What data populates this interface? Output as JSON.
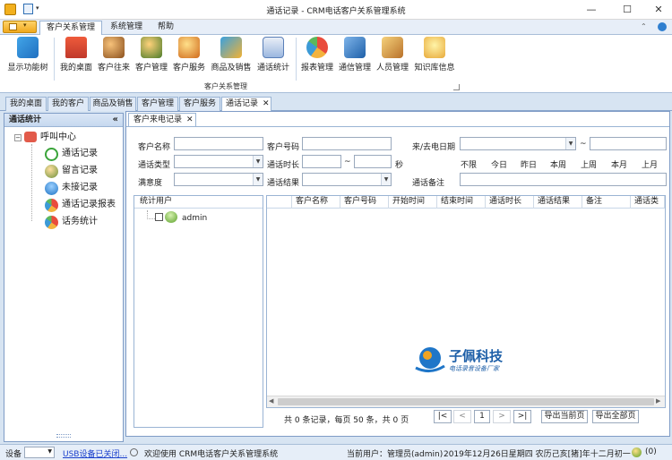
{
  "window": {
    "title": "通话记录 - CRM电话客户关系管理系统",
    "minimize": "—",
    "maximize": "☐",
    "close": "✕"
  },
  "ribbon_tabs": [
    "客户关系管理",
    "系统管理",
    "帮助"
  ],
  "ribbon_buttons": [
    {
      "label": "显示功能树",
      "icon": "tree-icon"
    },
    {
      "label": "我的桌面",
      "icon": "house-icon"
    },
    {
      "label": "客户往来",
      "icon": "people-icon"
    },
    {
      "label": "客户管理",
      "icon": "user-manage-icon"
    },
    {
      "label": "客户服务",
      "icon": "service-icon"
    },
    {
      "label": "商品及销售",
      "icon": "goods-icon"
    },
    {
      "label": "通话统计",
      "icon": "stats-icon"
    },
    {
      "label": "报表管理",
      "icon": "pie-chart-icon"
    },
    {
      "label": "通信管理",
      "icon": "communication-icon"
    },
    {
      "label": "人员管理",
      "icon": "staff-icon"
    },
    {
      "label": "知识库信息",
      "icon": "knowledge-icon"
    }
  ],
  "ribbon_group": "客户关系管理",
  "doc_tabs": [
    "我的桌面",
    "我的客户",
    "商品及销售",
    "客户管理",
    "客户服务",
    "通话记录"
  ],
  "left_panel": {
    "title": "通话统计",
    "collapse": "«",
    "root": "呼叫中心",
    "items": [
      "通话记录",
      "留言记录",
      "未接记录",
      "通话记录报表",
      "话务统计"
    ]
  },
  "inner_tab": "客户来电记录",
  "filters": {
    "customer_name": "客户名称",
    "customer_number": "客户号码",
    "call_date": "来/去电日期",
    "tilde": "~",
    "call_type": "通话类型",
    "duration": "通话时长",
    "seconds": "秒",
    "satisfaction": "满意度",
    "result": "通话结果",
    "remark": "通话备注",
    "quick": [
      "不限",
      "今日",
      "昨日",
      "本周",
      "上周",
      "本月",
      "上月"
    ]
  },
  "user_panel": {
    "title": "统计用户",
    "user": "admin"
  },
  "grid_columns": [
    "客户名称",
    "客户号码",
    "开始时间",
    "结束时间",
    "通话时长",
    "通话结果",
    "备注",
    "通话类"
  ],
  "watermark": {
    "name": "子佩科技",
    "slogan": "电话录音设备厂家"
  },
  "pager": {
    "summary": "共 0 条记录，每页 50 条，共 0 页",
    "first": "|<",
    "prev": "<",
    "page": "1",
    "next": ">",
    "last": ">|",
    "export_page": "导出当前页",
    "export_all": "导出全部页"
  },
  "status": {
    "device_label": "设备",
    "usb": "USB设备已关闭...",
    "welcome": "欢迎使用 CRM电话客户关系管理系统",
    "current_user": "当前用户：管理员(admin)",
    "datetime": "2019年12月26日星期四 农历己亥[猪]年十二月初一",
    "count": "(0)"
  }
}
